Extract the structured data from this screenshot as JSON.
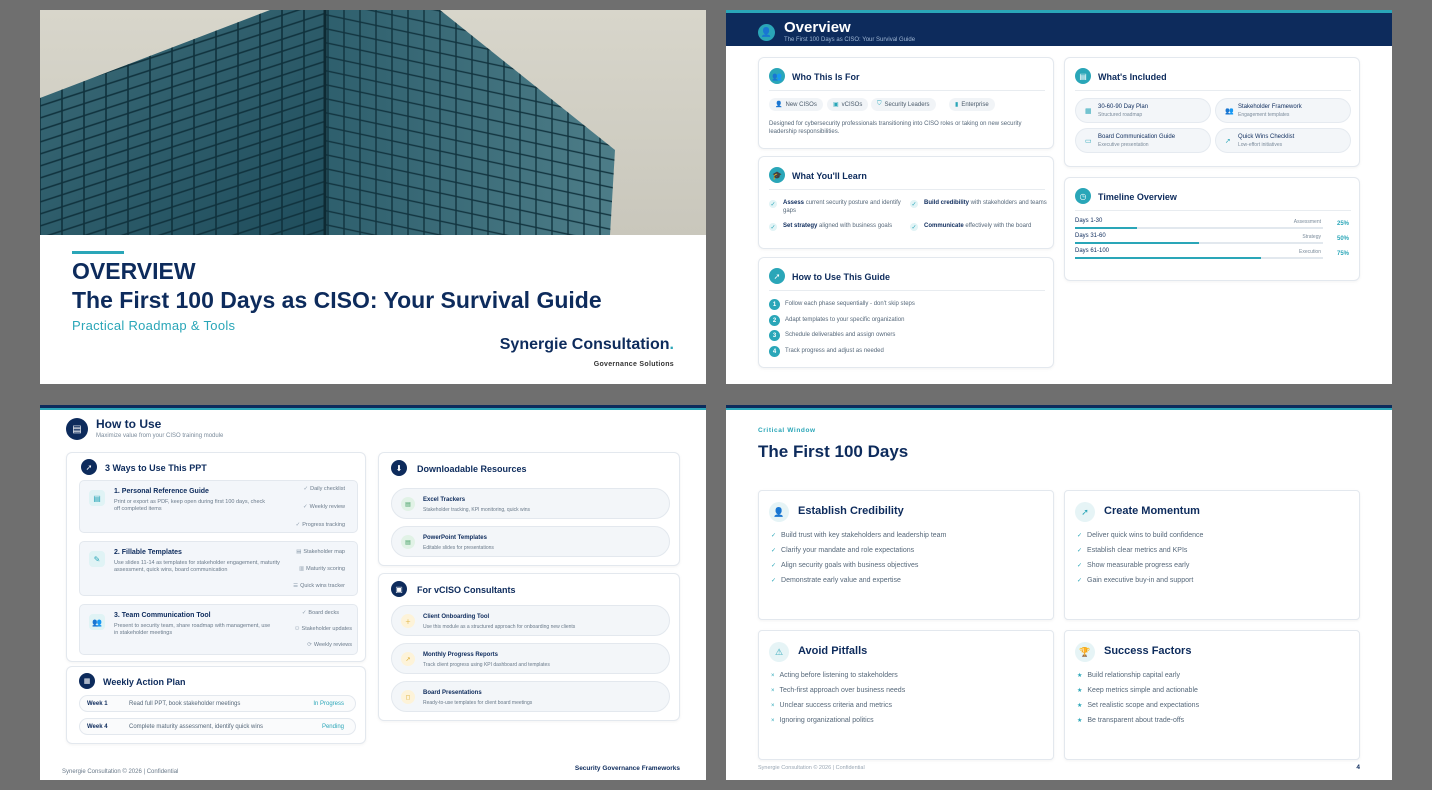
{
  "slide1": {
    "line1": "OVERVIEW",
    "line2": "The First 100 Days as CISO: Your Survival Guide",
    "subtitle": "Practical Roadmap & Tools",
    "brand": "Synergie Consultation",
    "brand_dot": ".",
    "brand_sub": "Governance Solutions"
  },
  "slide2": {
    "title": "Overview",
    "subtitle": "The First 100 Days as CISO: Your Survival Guide",
    "who": {
      "title": "Who This Is For",
      "chips": [
        "New CISOs",
        "vCISOs",
        "Security Leaders",
        "Enterprise"
      ],
      "desc": "Designed for cybersecurity professionals transitioning into CISO roles or taking on new security leadership responsibilities."
    },
    "learn": {
      "title": "What You'll Learn",
      "items": [
        {
          "bold": "Assess",
          "rest": " current security posture and identify gaps"
        },
        {
          "bold": "Build credibility",
          "rest": " with stakeholders and teams"
        },
        {
          "bold": "Set strategy",
          "rest": " aligned with business goals"
        },
        {
          "bold": "Communicate",
          "rest": " effectively with the board"
        }
      ]
    },
    "howto": {
      "title": "How to Use This Guide",
      "steps": [
        "Follow each phase sequentially - don't skip steps",
        "Adapt templates to your specific organization",
        "Schedule deliverables and assign owners",
        "Track progress and adjust as needed"
      ]
    },
    "included": {
      "title": "What's Included",
      "items": [
        {
          "t": "30-60-90 Day Plan",
          "d": "Structured roadmap"
        },
        {
          "t": "Stakeholder Framework",
          "d": "Engagement templates"
        },
        {
          "t": "Board Communication Guide",
          "d": "Executive presentation"
        },
        {
          "t": "Quick Wins Checklist",
          "d": "Low-effort initiatives"
        }
      ]
    },
    "timeline": {
      "title": "Timeline Overview",
      "rows": [
        {
          "label": "Days 1-30",
          "phase": "Assessment",
          "pct": "25%",
          "value": 0.25
        },
        {
          "label": "Days 31-60",
          "phase": "Strategy",
          "pct": "50%",
          "value": 0.5
        },
        {
          "label": "Days 61-100",
          "phase": "Execution",
          "pct": "75%",
          "value": 0.75
        }
      ]
    }
  },
  "slide3": {
    "title": "How to Use",
    "subtitle": "Maximize value from your CISO training module",
    "ways_title": "3 Ways to Use This PPT",
    "ways": [
      {
        "t": "1. Personal Reference Guide",
        "d": "Print or export as PDF, keep open during first 100 days, check off completed items",
        "tags": [
          "Daily checklist",
          "Weekly review",
          "Progress tracking"
        ]
      },
      {
        "t": "2. Fillable Templates",
        "d": "Use slides 11-14 as templates for stakeholder engagement, maturity assessment, quick wins, board communication",
        "tags": [
          "Stakeholder map",
          "Maturity scoring",
          "Quick wins tracker"
        ]
      },
      {
        "t": "3. Team Communication Tool",
        "d": "Present to security team, share roadmap with management, use in stakeholder meetings",
        "tags": [
          "Board decks",
          "Stakeholder updates",
          "Weekly reviews"
        ]
      }
    ],
    "weekly_title": "Weekly Action Plan",
    "weekly": [
      {
        "w": "Week 1",
        "d": "Read full PPT, book stakeholder meetings",
        "s": "In Progress"
      },
      {
        "w": "Week 4",
        "d": "Complete maturity assessment, identify quick wins",
        "s": "Pending"
      }
    ],
    "downloads_title": "Downloadable Resources",
    "downloads": [
      {
        "t": "Excel Trackers",
        "d": "Stakeholder tracking, KPI monitoring, quick wins"
      },
      {
        "t": "PowerPoint Templates",
        "d": "Editable slides for presentations"
      }
    ],
    "vciso_title": "For vCISO Consultants",
    "vciso": [
      {
        "t": "Client Onboarding Tool",
        "d": "Use this module as a structured approach for onboarding new clients"
      },
      {
        "t": "Monthly Progress Reports",
        "d": "Track client progress using KPI dashboard and templates"
      },
      {
        "t": "Board Presentations",
        "d": "Ready-to-use templates for client board meetings"
      }
    ],
    "footer_left": "Synergie Consultation © 2026 | Confidential",
    "footer_right": "Security Governance Frameworks"
  },
  "slide4": {
    "kicker": "Critical Window",
    "title": "The First 100 Days",
    "cards": [
      {
        "h": "Establish Credibility",
        "mark": "✓",
        "items": [
          "Build trust with key stakeholders and leadership team",
          "Clarify your mandate and role expectations",
          "Align security goals with business objectives",
          "Demonstrate early value and expertise"
        ]
      },
      {
        "h": "Create Momentum",
        "mark": "✓",
        "items": [
          "Deliver quick wins to build confidence",
          "Establish clear metrics and KPIs",
          "Show measurable progress early",
          "Gain executive buy-in and support"
        ]
      },
      {
        "h": "Avoid Pitfalls",
        "mark": "×",
        "items": [
          "Acting before listening to stakeholders",
          "Tech-first approach over business needs",
          "Unclear success criteria and metrics",
          "Ignoring organizational politics"
        ]
      },
      {
        "h": "Success Factors",
        "mark": "★",
        "items": [
          "Build relationship capital early",
          "Keep metrics simple and actionable",
          "Set realistic scope and expectations",
          "Be transparent about trade-offs"
        ]
      }
    ],
    "footer_left": "Synergie Consultation © 2026 | Confidential",
    "page": "4"
  },
  "colors": {
    "navy": "#0d2b5c",
    "teal": "#2aa6b8"
  },
  "icons": [
    "users-icon",
    "graduation-cap-icon",
    "rocket-icon",
    "gift-icon",
    "clock-icon",
    "book-icon",
    "download-icon",
    "briefcase-icon",
    "calendar-icon",
    "shield-icon",
    "trophy-icon",
    "warning-icon"
  ]
}
